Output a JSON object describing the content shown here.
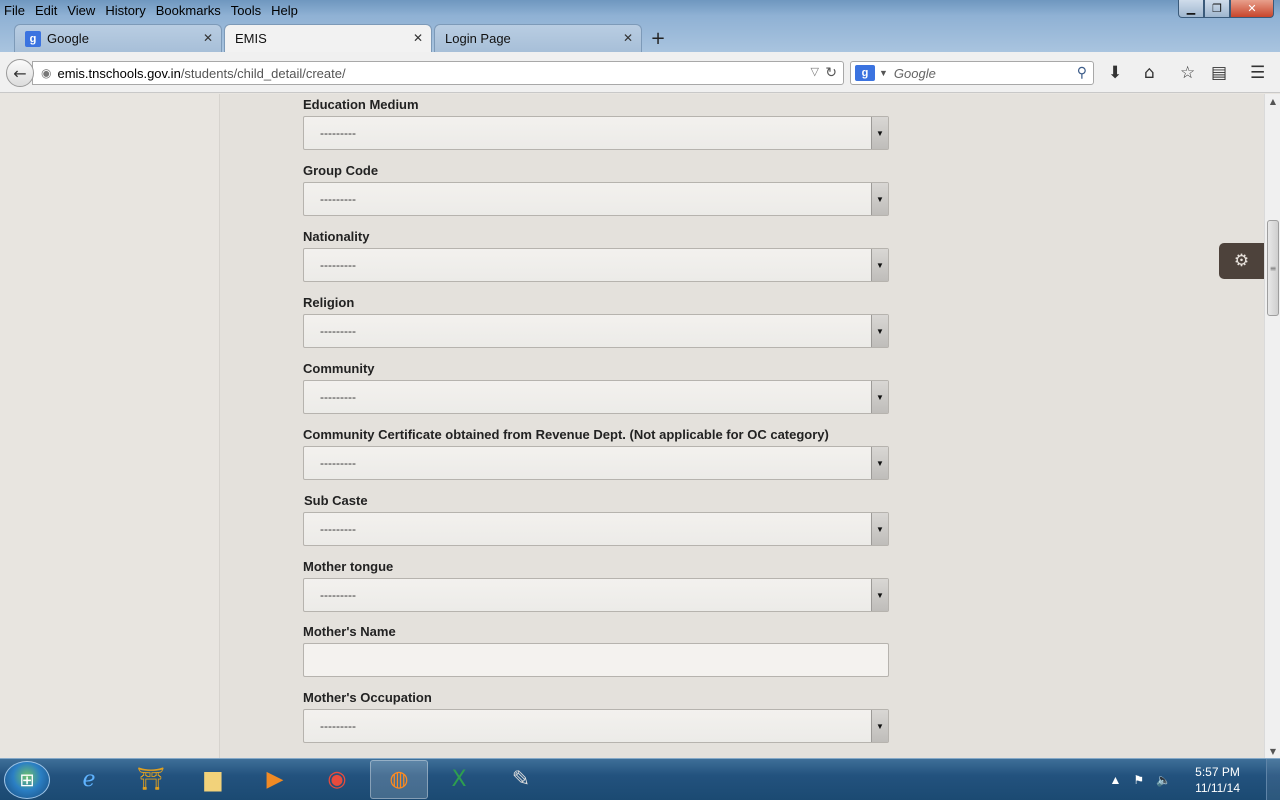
{
  "browser": {
    "menu": [
      "File",
      "Edit",
      "View",
      "History",
      "Bookmarks",
      "Tools",
      "Help"
    ],
    "tabs": [
      {
        "label": "Google",
        "favicon": "google-favicon",
        "active": false
      },
      {
        "label": "EMIS",
        "favicon": "",
        "active": true
      },
      {
        "label": "Login Page",
        "favicon": "",
        "active": false
      }
    ],
    "url_domain": "emis.tnschools.gov.in",
    "url_path": "/students/child_detail/create/",
    "search_placeholder": "Google",
    "search_engine_glyph": "g"
  },
  "form": {
    "fields": [
      {
        "label": "Education Medium",
        "type": "select",
        "value": "---------"
      },
      {
        "label": "Group Code",
        "type": "select",
        "value": "---------"
      },
      {
        "label": "Nationality",
        "type": "select",
        "value": "---------"
      },
      {
        "label": "Religion",
        "type": "select",
        "value": "---------"
      },
      {
        "label": "Community",
        "type": "select",
        "value": "---------"
      },
      {
        "label": "Community Certificate obtained from Revenue Dept. (Not applicable for OC category)",
        "type": "select",
        "value": "---------"
      },
      {
        "label": "Sub Caste",
        "type": "select",
        "value": "---------"
      },
      {
        "label": "Mother tongue",
        "type": "select",
        "value": "---------"
      },
      {
        "label": "Mother's Name",
        "type": "text",
        "value": ""
      },
      {
        "label": "Mother's Occupation",
        "type": "select",
        "value": "---------"
      }
    ]
  },
  "taskbar": {
    "apps": [
      "internet-explorer-icon",
      "tn-emblem-icon",
      "file-explorer-icon",
      "media-player-icon",
      "chrome-icon",
      "firefox-icon",
      "excel-icon",
      "paint-icon"
    ],
    "clock_time": "5:57 PM",
    "clock_date": "11/11/14"
  },
  "colors": {
    "page_bg": "#e8e5e0",
    "settings_button": "#4d423b",
    "taskbar": "#23527e"
  }
}
